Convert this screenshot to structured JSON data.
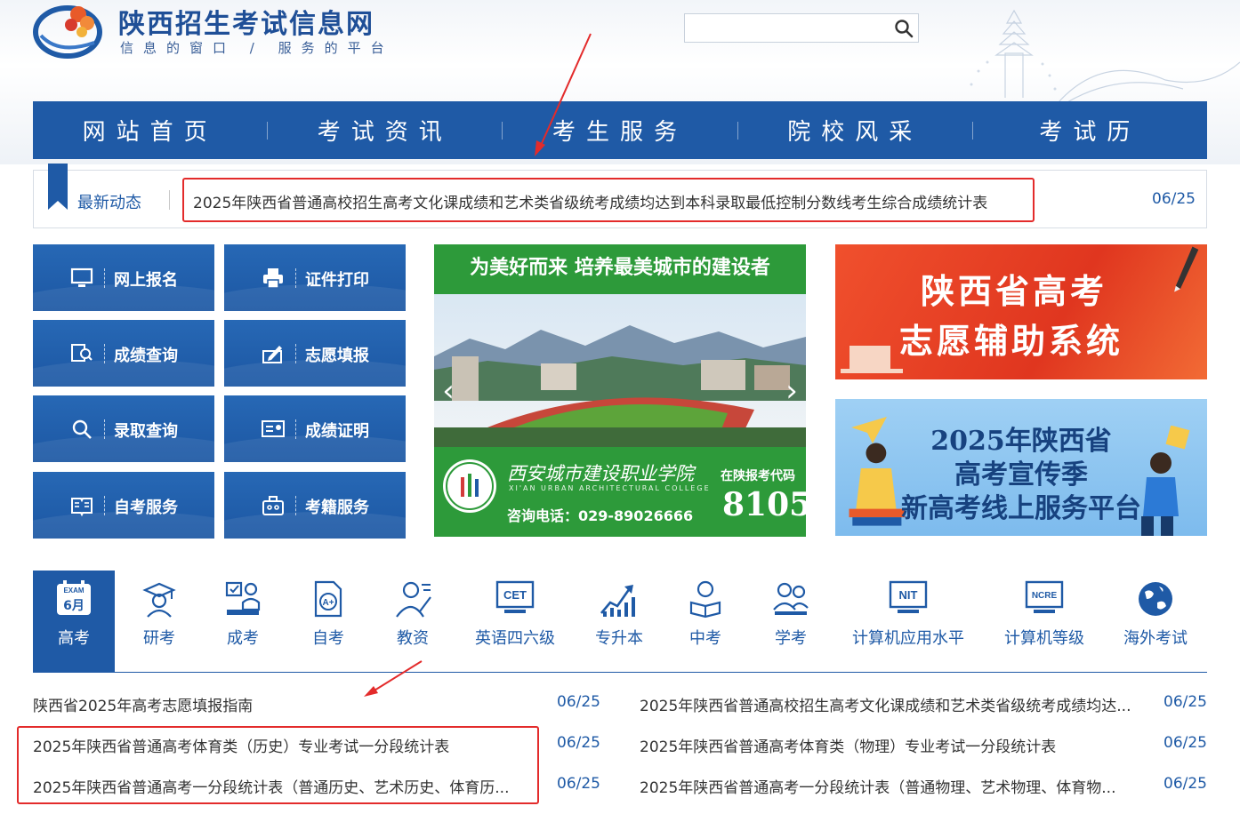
{
  "header": {
    "site_title": "陕西招生考试信息网",
    "slogan": "信息的窗口 / 服务的平台",
    "search_placeholder": ""
  },
  "nav": {
    "items": [
      "网站首页",
      "考试资讯",
      "考生服务",
      "院校风采",
      "考试历"
    ]
  },
  "ticker": {
    "label": "最新动态",
    "headline": "2025年陕西省普通高校招生高考文化课成绩和艺术类省级统考成绩均达到本科录取最低控制分数线考生综合成绩统计表",
    "date": "06/25"
  },
  "services": [
    {
      "label": "网上报名",
      "icon": "monitor-icon"
    },
    {
      "label": "证件打印",
      "icon": "printer-icon"
    },
    {
      "label": "成绩查询",
      "icon": "score-search-icon"
    },
    {
      "label": "志愿填报",
      "icon": "form-fill-icon"
    },
    {
      "label": "录取查询",
      "icon": "search-icon"
    },
    {
      "label": "成绩证明",
      "icon": "certificate-icon"
    },
    {
      "label": "自考服务",
      "icon": "book-icon"
    },
    {
      "label": "考籍服务",
      "icon": "briefcase-icon"
    }
  ],
  "banner": {
    "headline": "为美好而来 培养最美城市的建设者",
    "college_name": "西安城市建设职业学院",
    "college_name_en": "XI'AN URBAN ARCHITECTURAL COLLEGE",
    "phone": "咨询电话：029-89026666",
    "code_label": "在陕报考代码",
    "code": "8105"
  },
  "ads": {
    "ad1_line1": "陕西省高考",
    "ad1_line2": "志愿辅助系统",
    "ad2_line1": "2025年陕西省",
    "ad2_line2": "高考宣传季",
    "ad2_line3": "新高考线上服务平台"
  },
  "exam_tabs": {
    "active_badge_top": "EXAM",
    "active_badge_bottom": "6月",
    "items": [
      {
        "label": "高考",
        "icon": "exam-calendar-icon"
      },
      {
        "label": "研考",
        "icon": "graduate-icon"
      },
      {
        "label": "成考",
        "icon": "adult-exam-icon"
      },
      {
        "label": "自考",
        "icon": "self-study-icon"
      },
      {
        "label": "教资",
        "icon": "teacher-icon"
      },
      {
        "label": "英语四六级",
        "icon": "cet-icon"
      },
      {
        "label": "专升本",
        "icon": "growth-chart-icon"
      },
      {
        "label": "中考",
        "icon": "student-reading-icon"
      },
      {
        "label": "学考",
        "icon": "students-icon"
      },
      {
        "label": "计算机应用水平",
        "icon": "nit-icon"
      },
      {
        "label": "计算机等级",
        "icon": "ncre-icon"
      },
      {
        "label": "海外考试",
        "icon": "globe-icon"
      }
    ],
    "cet_text": "CET",
    "nit_text": "NIT",
    "ncre_text": "NCRE"
  },
  "news": {
    "left": [
      {
        "title": "陕西省2025年高考志愿填报指南",
        "date": "06/25"
      },
      {
        "title": "2025年陕西省普通高考体育类（历史）专业考试一分段统计表",
        "date": "06/25"
      },
      {
        "title": "2025年陕西省普通高考一分段统计表（普通历史、艺术历史、体育历...",
        "date": "06/25"
      }
    ],
    "right": [
      {
        "title": "2025年陕西省普通高校招生高考文化课成绩和艺术类省级统考成绩均达...",
        "date": "06/25"
      },
      {
        "title": "2025年陕西省普通高考体育类（物理）专业考试一分段统计表",
        "date": "06/25"
      },
      {
        "title": "2025年陕西省普通高考一分段统计表（普通物理、艺术物理、体育物...",
        "date": "06/25"
      }
    ]
  },
  "colors": {
    "primary_blue": "#1f5aa6",
    "annotation_red": "#e32b2b",
    "banner_green": "#2d9a3a",
    "ad_orange": "#e0361f"
  }
}
